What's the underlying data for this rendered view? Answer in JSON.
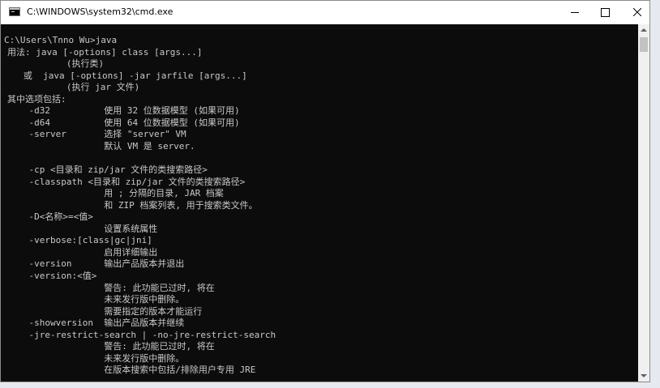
{
  "window": {
    "title": "C:\\WINDOWS\\system32\\cmd.exe",
    "icon": "console-app-icon",
    "controls": {
      "minimize": "minimize-icon",
      "maximize": "maximize-icon",
      "close": "close-icon"
    }
  },
  "console": {
    "background": "#0c0c0c",
    "foreground": "#c8c8c8",
    "lines": [
      "C:\\Users\\Tnno Wu>java",
      "用法: java [-options] class [args...]",
      "           (执行类)",
      "   或  java [-options] -jar jarfile [args...]",
      "           (执行 jar 文件)",
      "其中选项包括:",
      "    -d32          使用 32 位数据模型 (如果可用)",
      "    -d64          使用 64 位数据模型 (如果可用)",
      "    -server       选择 \"server\" VM",
      "                  默认 VM 是 server.",
      "",
      "    -cp <目录和 zip/jar 文件的类搜索路径>",
      "    -classpath <目录和 zip/jar 文件的类搜索路径>",
      "                  用 ; 分隔的目录, JAR 档案",
      "                  和 ZIP 档案列表, 用于搜索类文件。",
      "    -D<名称>=<值>",
      "                  设置系统属性",
      "    -verbose:[class|gc|jni]",
      "                  启用详细输出",
      "    -version      输出产品版本并退出",
      "    -version:<值>",
      "                  警告: 此功能已过时, 将在",
      "                  未来发行版中删除。",
      "                  需要指定的版本才能运行",
      "    -showversion  输出产品版本并继续",
      "    -jre-restrict-search | -no-jre-restrict-search",
      "                  警告: 此功能已过时, 将在",
      "                  未来发行版中删除。",
      "                  在版本搜索中包括/排除用户专用 JRE"
    ]
  }
}
